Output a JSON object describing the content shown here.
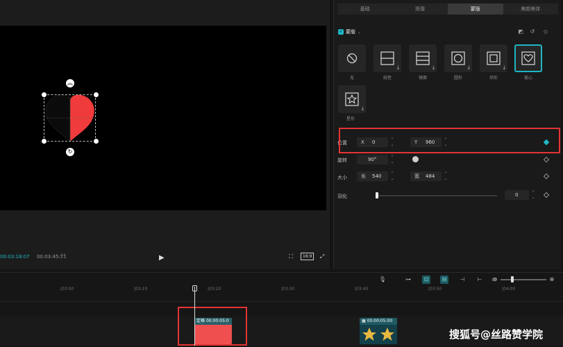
{
  "preview": {
    "current_time": "00:03:18:07",
    "total_time": "00:03:45:21",
    "ratio_label": "16:9"
  },
  "panel": {
    "tabs": [
      {
        "label": "基础",
        "active": false
      },
      {
        "label": "抠像",
        "active": false
      },
      {
        "label": "蒙版",
        "active": true
      },
      {
        "label": "美颜美体",
        "active": false
      }
    ],
    "mask_title": "蒙版",
    "shapes": [
      {
        "label": "无",
        "icon": "no-mask-icon"
      },
      {
        "label": "线性",
        "icon": "linear-mask-icon"
      },
      {
        "label": "镜面",
        "icon": "mirror-mask-icon"
      },
      {
        "label": "圆形",
        "icon": "circle-mask-icon"
      },
      {
        "label": "矩形",
        "icon": "rectangle-mask-icon"
      },
      {
        "label": "爱心",
        "icon": "heart-mask-icon",
        "selected": true
      },
      {
        "label": "星形",
        "icon": "star-mask-icon"
      }
    ],
    "position": {
      "label": "位置",
      "x_key": "X",
      "x": "0",
      "y_key": "Y",
      "y": "960"
    },
    "rotate": {
      "label": "旋转",
      "value": "90°"
    },
    "size": {
      "label": "大小",
      "w_key": "长",
      "w": "540",
      "h_key": "宽",
      "h": "484"
    },
    "feather": {
      "label": "羽化",
      "value": "0"
    },
    "accent": "#1fb6c4"
  },
  "timeline": {
    "ruler": [
      "|03:00",
      "|03:10",
      "|03:20",
      "|03:30",
      "|03:40",
      "|03:50",
      "|04:00"
    ],
    "clip1": {
      "tag": "定格",
      "duration": "00:00:05:0"
    },
    "clip2": {
      "duration": "00:00:05:00"
    }
  },
  "watermark": "搜狐号@丝路赞学院"
}
